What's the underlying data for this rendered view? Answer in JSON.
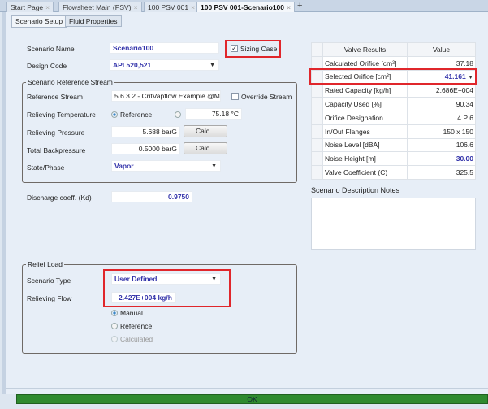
{
  "tabs": [
    {
      "label": "Start Page"
    },
    {
      "label": "Flowsheet Main (PSV)"
    },
    {
      "label": "100 PSV 001"
    },
    {
      "label": "100 PSV 001-Scenario100",
      "active": true
    }
  ],
  "subtabs": [
    {
      "label": "Scenario Setup"
    },
    {
      "label": "Fluid Properties"
    }
  ],
  "form": {
    "scenario_name_label": "Scenario Name",
    "scenario_name": "Scenario100",
    "sizing_case_label": "Sizing Case",
    "sizing_case_checked": true,
    "design_code_label": "Design Code",
    "design_code": "API 520,521",
    "ref_group_title": "Scenario Reference Stream",
    "ref_stream_label": "Reference Stream",
    "ref_stream": "5.6.3.2 - CritVapflow Example @M:",
    "override_label": "Override Stream",
    "rel_temp_label": "Relieving Temperature",
    "rel_temp_radio": "Reference",
    "rel_temp_value": "75.18 °C",
    "rel_pressure_label": "Relieving Pressure",
    "rel_pressure": "5.688 barG",
    "calc_label": "Calc...",
    "backpressure_label": "Total Backpressure",
    "backpressure": "0.5000 barG",
    "state_label": "State/Phase",
    "state": "Vapor",
    "kd_label": "Discharge coeff. (Kd)",
    "kd": "0.9750",
    "relief_group_title": "Relief Load",
    "scenario_type_label": "Scenario Type",
    "scenario_type": "User Defined",
    "rel_flow_label": "Relieving Flow",
    "rel_flow": "2.427E+004 kg/h",
    "flow_options": [
      {
        "label": "Manual",
        "selected": true
      },
      {
        "label": "Reference"
      },
      {
        "label": "Calculated",
        "disabled": true
      }
    ]
  },
  "results": {
    "headers": [
      "Valve Results",
      "Value"
    ],
    "rows": [
      {
        "name": "Calculated Orifice [cm²]",
        "value": "37.18"
      },
      {
        "name": "Selected Orifice [cm²]",
        "value": "41.161"
      },
      {
        "name": "Rated Capacity [kg/h]",
        "value": "2.686E+004"
      },
      {
        "name": "Capacity Used [%]",
        "value": "90.34"
      },
      {
        "name": "Orifice Designation",
        "value": "4 P 6"
      },
      {
        "name": "In/Out Flanges",
        "value": "150 x 150"
      },
      {
        "name": "Noise Level [dBA]",
        "value": "106.6"
      },
      {
        "name": "Noise Height [m]",
        "value": "30.00"
      },
      {
        "name": "Valve Coefficient (C)",
        "value": "325.5"
      }
    ]
  },
  "notes_label": "Scenario Description Notes",
  "ok_label": "OK",
  "colors": {
    "highlight": "#e0262b",
    "value_blue": "#3333aa",
    "ok_green": "#2f8a2f"
  }
}
